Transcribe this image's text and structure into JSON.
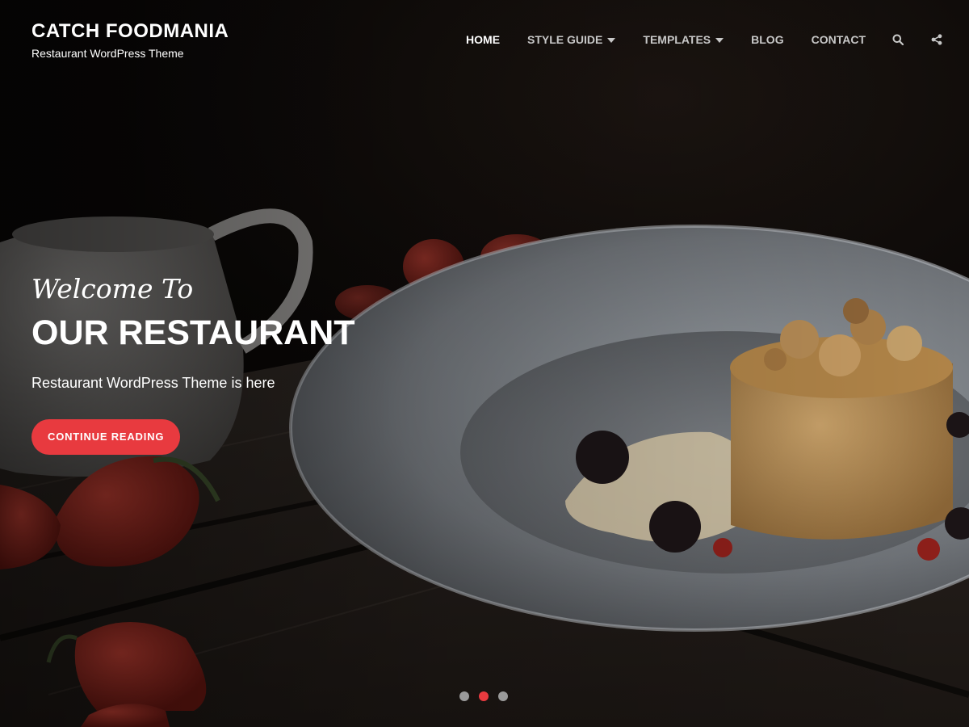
{
  "site": {
    "title": "CATCH FOODMANIA",
    "tagline": "Restaurant WordPress Theme"
  },
  "nav": {
    "items": [
      {
        "label": "HOME",
        "active": true,
        "has_dropdown": false
      },
      {
        "label": "STYLE GUIDE",
        "active": false,
        "has_dropdown": true
      },
      {
        "label": "TEMPLATES",
        "active": false,
        "has_dropdown": true
      },
      {
        "label": "BLOG",
        "active": false,
        "has_dropdown": false
      },
      {
        "label": "CONTACT",
        "active": false,
        "has_dropdown": false
      }
    ],
    "icons": [
      "search-icon",
      "share-icon"
    ]
  },
  "slider": {
    "kicker": "Welcome To",
    "title": "OUR RESTAURANT",
    "text": "Restaurant WordPress Theme is here",
    "button_label": "CONTINUE READING",
    "slide_count": 3,
    "active_slide": 2
  },
  "colors": {
    "accent": "#e83a3f",
    "nav_text": "#c8c8c8",
    "nav_active": "#ffffff",
    "dot_inactive": "#9a9a9a"
  }
}
